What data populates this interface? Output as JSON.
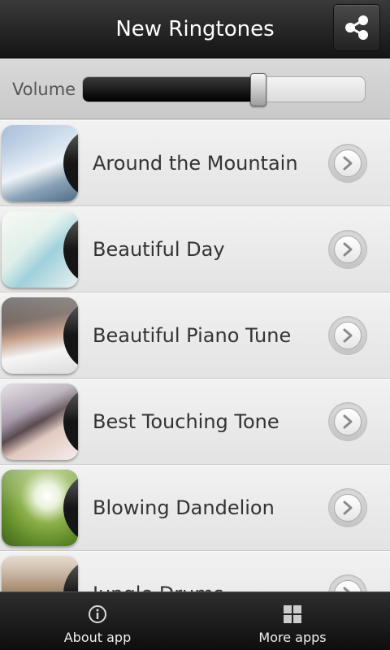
{
  "header": {
    "title": "New Ringtones",
    "share_icon": "share-icon"
  },
  "volume": {
    "label": "Volume",
    "level": 0.6
  },
  "ringtones": [
    {
      "title": "Around the Mountain",
      "thumbnail": "mountain-thumbnail"
    },
    {
      "title": "Beautiful Day",
      "thumbnail": "day-thumbnail"
    },
    {
      "title": "Beautiful Piano Tune",
      "thumbnail": "piano-thumbnail"
    },
    {
      "title": "Best Touching Tone",
      "thumbnail": "portrait-thumbnail"
    },
    {
      "title": "Blowing Dandelion",
      "thumbnail": "dandelion-thumbnail"
    },
    {
      "title": "Jungle Drums",
      "thumbnail": "jungle-thumbnail"
    }
  ],
  "bottom_nav": {
    "about_label": "About app",
    "about_icon": "info-icon",
    "more_label": "More apps",
    "more_icon": "grid-icon"
  },
  "colors": {
    "header_bg": "#1c1c1c",
    "list_bg": "#ececec",
    "text": "#333333"
  }
}
